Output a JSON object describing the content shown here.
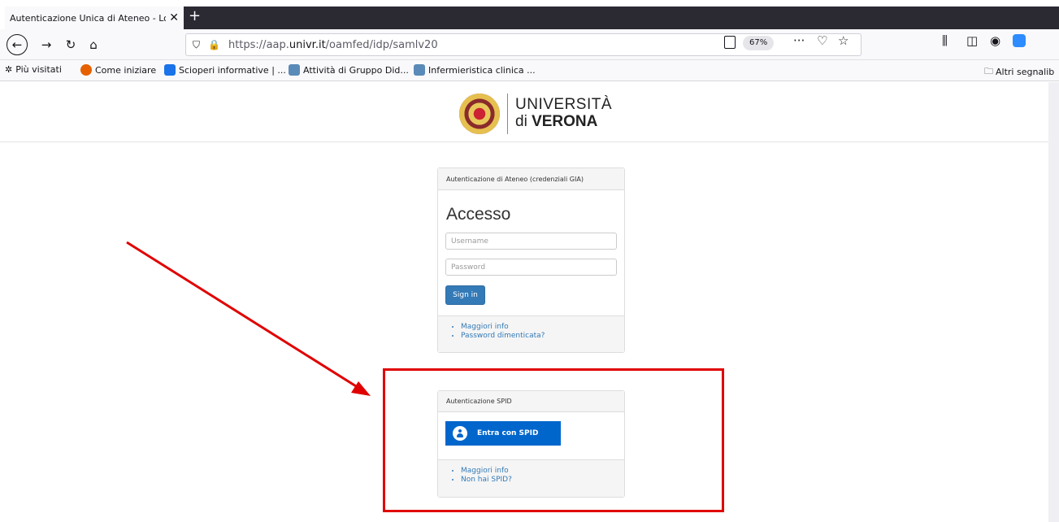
{
  "browser": {
    "tab_title": "Autenticazione Unica di Ateneo - Lo",
    "url_prefix": "https://aap.",
    "url_domain": "univr.it",
    "url_path": "/oamfed/idp/samlv20",
    "zoom": "67%"
  },
  "bookmarks": [
    {
      "label": "Più visitati"
    },
    {
      "label": "Come iniziare"
    },
    {
      "label": "Scioperi informative | ..."
    },
    {
      "label": "Attività di Gruppo Did..."
    },
    {
      "label": "Infermieristica clinica ..."
    },
    {
      "label": "Altri segnalib"
    }
  ],
  "logo": {
    "line1": "UNIVERSITÀ",
    "line2_prefix": "di ",
    "line2_bold": "VERONA"
  },
  "login_panel": {
    "heading": "Autenticazione di Ateneo (credenziali GIA)",
    "title": "Accesso",
    "username_placeholder": "Username",
    "password_placeholder": "Password",
    "signin_label": "Sign in",
    "links": [
      "Maggiori info",
      "Password dimenticata?"
    ]
  },
  "spid_panel": {
    "heading": "Autenticazione SPID",
    "button_label": "Entra con SPID",
    "links": [
      "Maggiori info",
      "Non hai SPID?"
    ]
  },
  "colors": {
    "accent": "#337ab7",
    "spid_blue": "#0066cc",
    "annotation_red": "#e00000"
  }
}
